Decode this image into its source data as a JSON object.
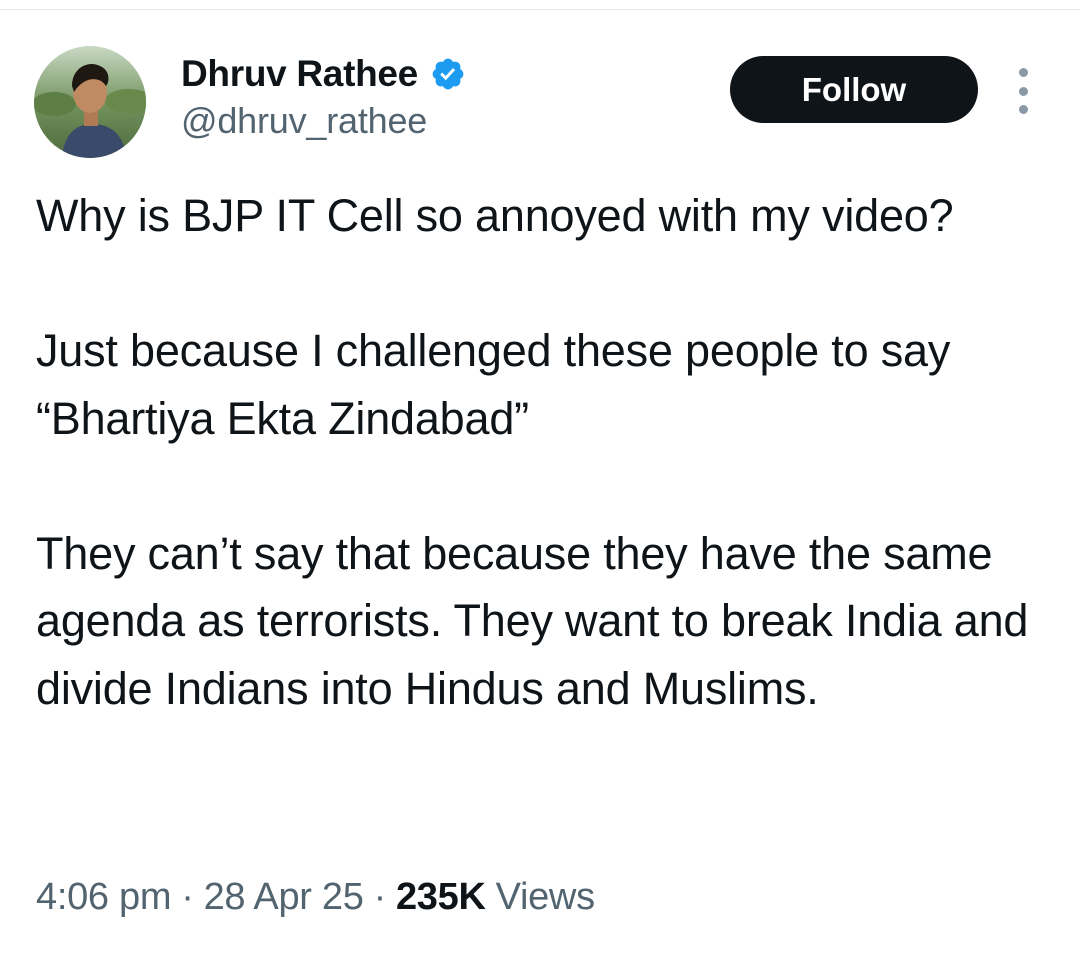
{
  "tweet": {
    "author": {
      "display_name": "Dhruv Rathee",
      "handle": "@dhruv_rathee",
      "verified": true,
      "verified_color": "#1d9bf0",
      "avatar_icon": "profile-photo"
    },
    "follow_label": "Follow",
    "more_icon": "vertical-ellipsis-icon",
    "paragraphs": [
      "Why is BJP IT Cell so annoyed with my video?",
      "Just because I challenged these people to say “Bhartiya Ekta Zindabad”",
      "They can’t say that because they have the same agenda as terrorists. They want to break India and divide Indians into Hindus and Muslims."
    ],
    "time": "4:06 pm",
    "date": "28 Apr 25",
    "separator": "·",
    "views_count": "235K",
    "views_label": "Views"
  },
  "colors": {
    "text_primary": "#0f1419",
    "text_secondary": "#536471",
    "button_bg": "#0f1419",
    "button_text": "#ffffff",
    "verified_blue": "#1d9bf0"
  }
}
